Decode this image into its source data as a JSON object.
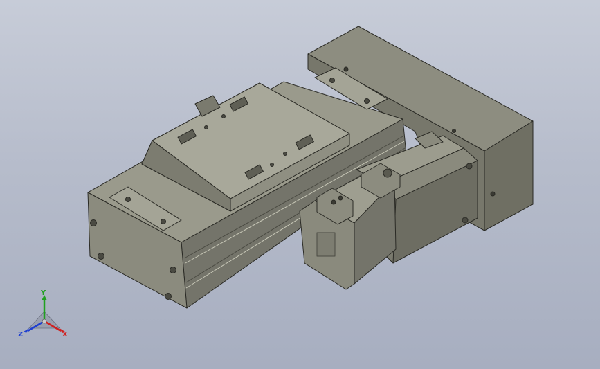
{
  "viewport": {
    "background_top": "#c7ccd8",
    "background_bottom": "#a7aec0",
    "model_color": "#8a8a7c"
  },
  "triad": {
    "x_label": "X",
    "y_label": "Y",
    "z_label": "Z",
    "x_color": "#d02020",
    "y_color": "#20a020",
    "z_color": "#2040d0"
  }
}
